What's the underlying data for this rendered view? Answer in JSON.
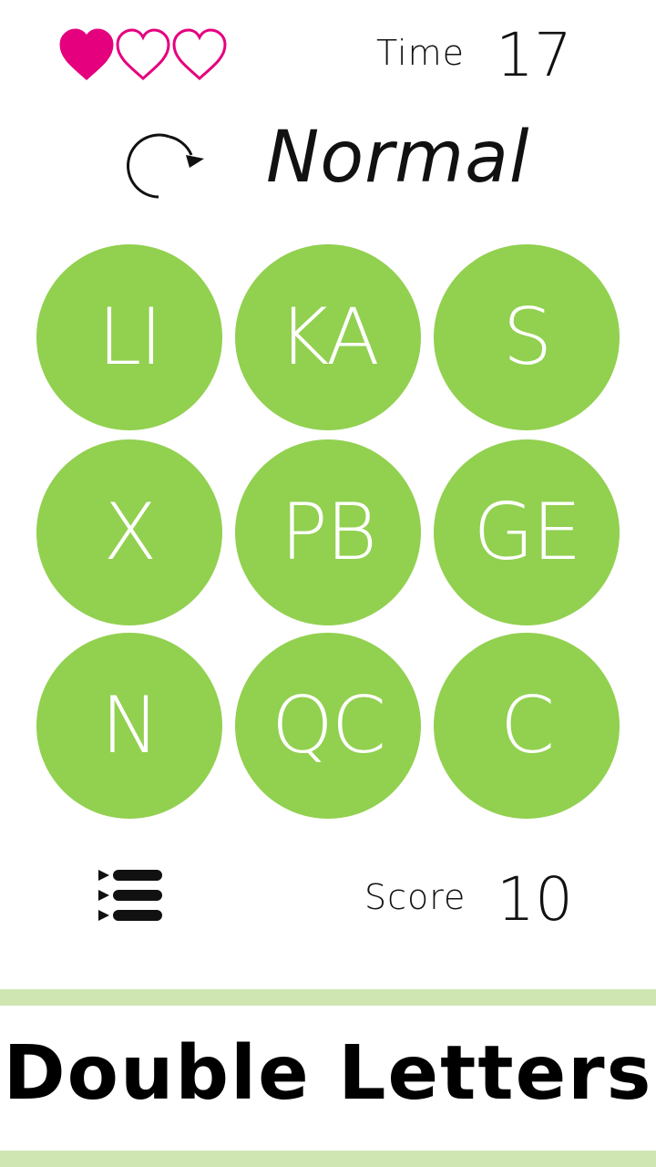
{
  "lives": {
    "total": 3,
    "remaining": 1,
    "filled_color": "#e5007e",
    "outline_color": "#e5007e"
  },
  "timer": {
    "label": "Time",
    "value": "17"
  },
  "mode": {
    "restart_icon": "restart-icon",
    "label": "Normal"
  },
  "tiles": [
    {
      "text": "LI"
    },
    {
      "text": "KA"
    },
    {
      "text": "S"
    },
    {
      "text": "X"
    },
    {
      "text": "PB"
    },
    {
      "text": "GE"
    },
    {
      "text": "N"
    },
    {
      "text": "QC"
    },
    {
      "text": "C"
    }
  ],
  "tile_color": "#92d050",
  "footer": {
    "menu_icon": "list-menu-icon",
    "score_label": "Score",
    "score_value": "10"
  },
  "banner": {
    "title": "Double Letters",
    "stripe_color": "#cfe6b3"
  }
}
